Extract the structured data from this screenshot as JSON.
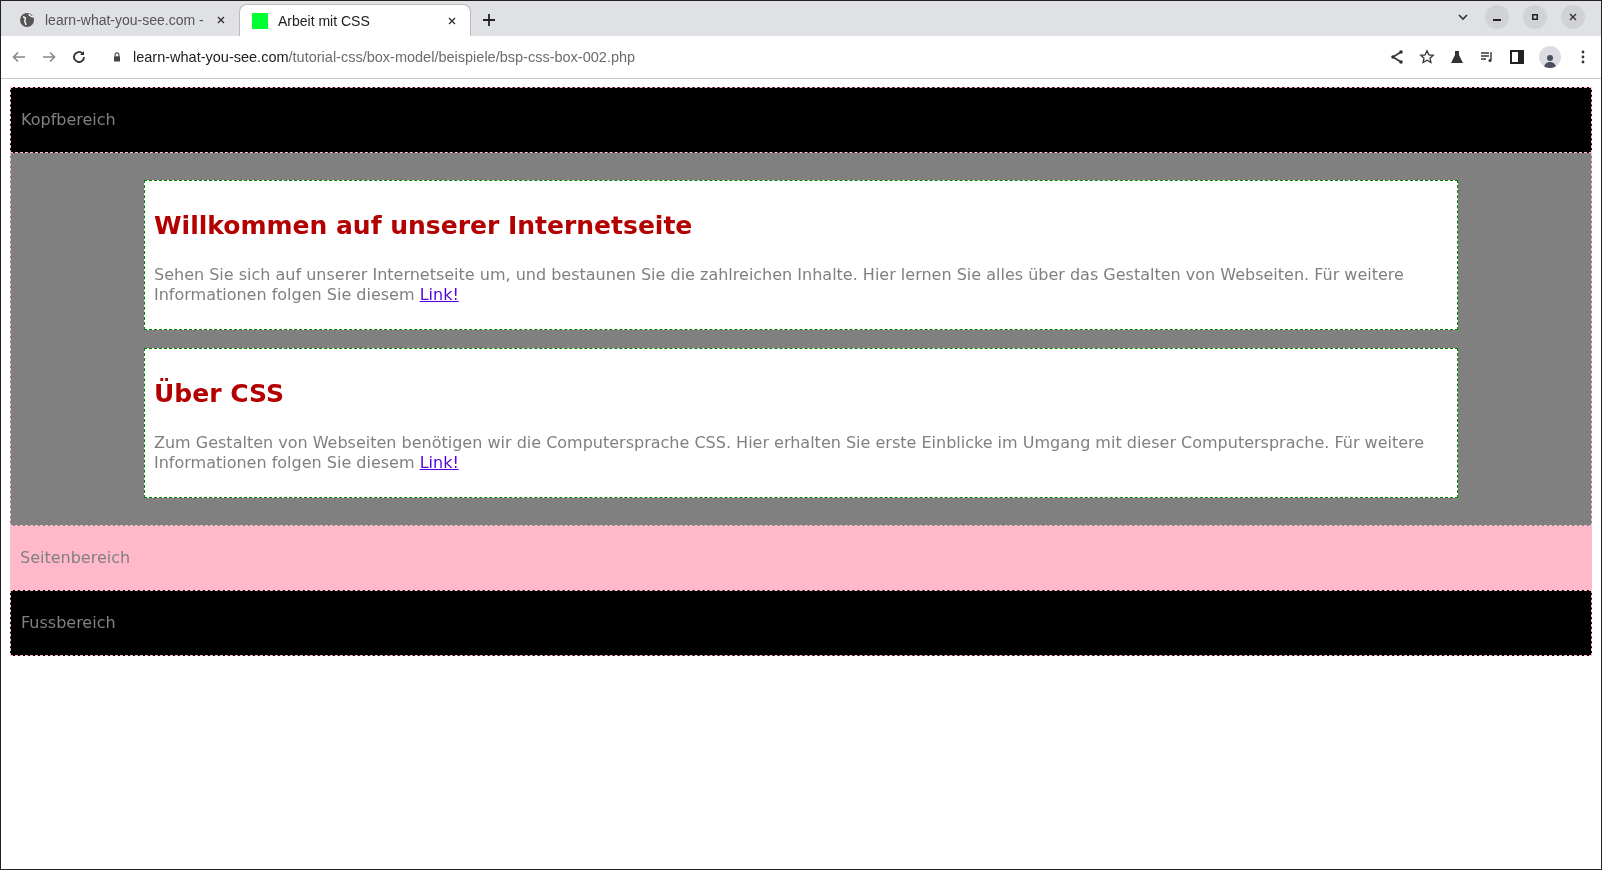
{
  "browser": {
    "tabs": [
      {
        "title": "learn-what-you-see.com -",
        "selected": false,
        "kind": "globe"
      },
      {
        "title": "Arbeit mit CSS",
        "selected": true,
        "kind": "square"
      }
    ],
    "address": {
      "domain": "learn-what-you-see.com",
      "path": "/tutorial-css/box-model/beispiele/bsp-css-box-002.php"
    }
  },
  "page": {
    "header": "Kopfbereich",
    "articles": [
      {
        "heading": "Willkommen auf unserer Internetseite",
        "text": "Sehen Sie sich auf unserer Internetseite um, und bestaunen Sie die zahlreichen Inhalte. Hier lernen Sie alles über das Gestalten von Webseiten. Für weitere Informationen folgen Sie diesem",
        "link": "Link!"
      },
      {
        "heading": "Über CSS",
        "text": "Zum Gestalten von Webseiten benötigen wir die Computersprache CSS. Hier erhalten Sie erste Einblicke im Umgang mit dieser Computersprache. Für weitere Informationen folgen Sie diesem",
        "link": "Link!"
      }
    ],
    "sidebar": "Seitenbereich",
    "footer": "Fussbereich"
  }
}
